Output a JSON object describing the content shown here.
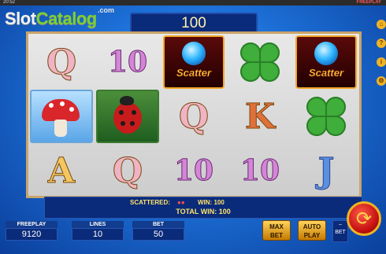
{
  "status_bar": {
    "time": "20:52",
    "mode": "FREEPLAY"
  },
  "logo": {
    "slot": "Slot",
    "catalog": "Catalog",
    "com": ".com"
  },
  "bet_display": "100",
  "side_icons": [
    "home-icon",
    "help-icon",
    "info-icon",
    "settings-icon"
  ],
  "reels": [
    [
      "Q",
      "mushroom",
      "A"
    ],
    [
      "10",
      "ladybug",
      "Q"
    ],
    [
      "scatter",
      "Q",
      "10"
    ],
    [
      "clover",
      "K",
      "10"
    ],
    [
      "scatter",
      "clover",
      "J"
    ]
  ],
  "scatter_label": "Scatter",
  "info": {
    "scattered_label": "SCATTERED:",
    "win_label": "WIN: 100",
    "total_win_label": "TOTAL WIN: 100"
  },
  "stats": {
    "freeplay_label": "FREEPLAY",
    "freeplay_value": "9120",
    "lines_label": "LINES",
    "lines_value": "10",
    "bet_label": "BET",
    "bet_value": "50"
  },
  "buttons": {
    "max_bet_line1": "MAX",
    "max_bet_line2": "BET",
    "auto_play_line1": "AUTO",
    "auto_play_line2": "PLAY",
    "bet_minus_line1": "–",
    "bet_minus_line2": "BET"
  },
  "colors": {
    "accent": "#f0b323",
    "panel": "#0a2a7a",
    "text_yellow": "#ffe36a"
  }
}
